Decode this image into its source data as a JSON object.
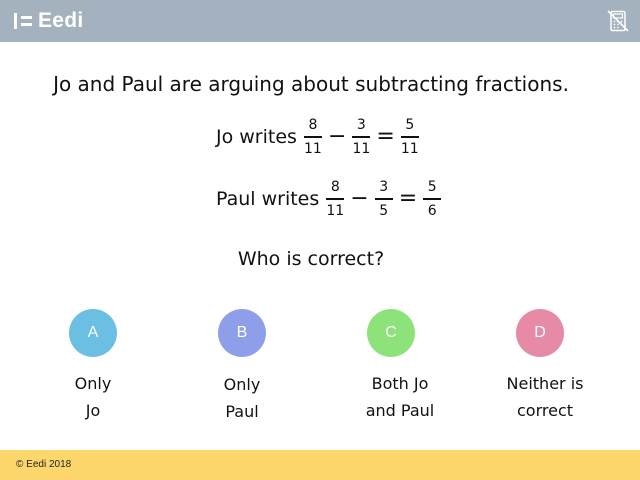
{
  "header": {
    "logo_text": "Eedi",
    "calculator_icon": "no-calculator-icon",
    "background": "#a4b1bf"
  },
  "question": {
    "intro": "Jo and Paul are arguing about subtracting fractions.",
    "jo": {
      "label": "Jo writes",
      "a_num": "8",
      "a_den": "11",
      "minus": "−",
      "b_num": "3",
      "b_den": "11",
      "equals": "=",
      "c_num": "5",
      "c_den": "11"
    },
    "paul": {
      "label": "Paul writes",
      "a_num": "8",
      "a_den": "11",
      "minus": "−",
      "b_num": "3",
      "b_den": "5",
      "equals": "=",
      "c_num": "5",
      "c_den": "6"
    },
    "prompt": "Who is correct?"
  },
  "options": [
    {
      "letter": "A",
      "line1": "Only",
      "line2": "Jo",
      "color": "#6bbfe3"
    },
    {
      "letter": "B",
      "line1": "Only",
      "line2": "Paul",
      "color": "#8f9ee8"
    },
    {
      "letter": "C",
      "line1": "Both Jo",
      "line2": "and Paul",
      "color": "#8ee27a"
    },
    {
      "letter": "D",
      "line1": "Neither is",
      "line2": "correct",
      "color": "#e68aa6"
    }
  ],
  "footer": {
    "copyright": "© Eedi 2018",
    "background": "#fdd76b"
  }
}
